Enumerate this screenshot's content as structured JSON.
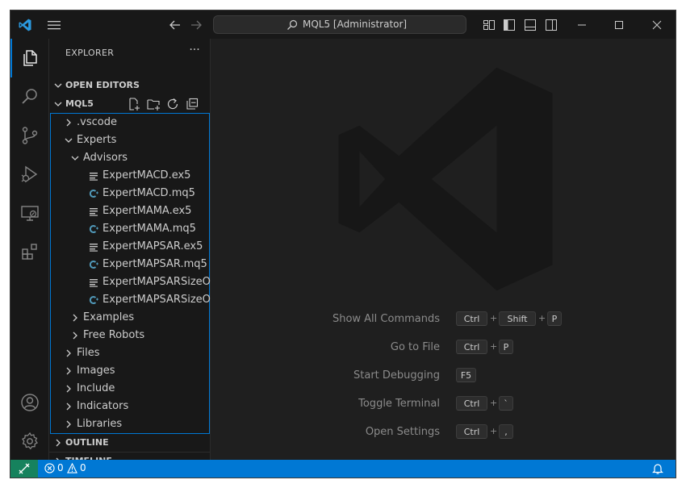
{
  "titlebar": {
    "command_center_text": "MQL5 [Administrator]",
    "back_icon": "arrow-left-icon",
    "forward_icon": "arrow-right-icon"
  },
  "activity_bar": {
    "items": [
      "files-icon",
      "search-icon",
      "source-control-icon",
      "run-debug-icon",
      "remote-explorer-icon",
      "extensions-icon"
    ],
    "bottom_items": [
      "account-icon",
      "manage-gear-icon"
    ]
  },
  "sidebar": {
    "title": "EXPLORER",
    "more": "···",
    "open_editors_label": "OPEN EDITORS",
    "folder_label": "MQL5",
    "outline_label": "OUTLINE",
    "timeline_label": "TIMELINE",
    "tree": [
      {
        "name": ".vscode",
        "type": "folder",
        "expanded": false,
        "depth": 0
      },
      {
        "name": "Experts",
        "type": "folder",
        "expanded": true,
        "depth": 0
      },
      {
        "name": "Advisors",
        "type": "folder",
        "expanded": true,
        "depth": 1
      },
      {
        "name": "ExpertMACD.ex5",
        "type": "file-lines",
        "depth": 2
      },
      {
        "name": "ExpertMACD.mq5",
        "type": "file-c",
        "depth": 2
      },
      {
        "name": "ExpertMAMA.ex5",
        "type": "file-lines",
        "depth": 2
      },
      {
        "name": "ExpertMAMA.mq5",
        "type": "file-c",
        "depth": 2
      },
      {
        "name": "ExpertMAPSAR.ex5",
        "type": "file-lines",
        "depth": 2
      },
      {
        "name": "ExpertMAPSAR.mq5",
        "type": "file-c",
        "depth": 2
      },
      {
        "name": "ExpertMAPSARSizeOpti...",
        "type": "file-lines",
        "depth": 2
      },
      {
        "name": "ExpertMAPSARSizeOpti...",
        "type": "file-c",
        "depth": 2
      },
      {
        "name": "Examples",
        "type": "folder",
        "expanded": false,
        "depth": 1
      },
      {
        "name": "Free Robots",
        "type": "folder",
        "expanded": false,
        "depth": 1
      },
      {
        "name": "Files",
        "type": "folder",
        "expanded": false,
        "depth": 0
      },
      {
        "name": "Images",
        "type": "folder",
        "expanded": false,
        "depth": 0
      },
      {
        "name": "Include",
        "type": "folder",
        "expanded": false,
        "depth": 0
      },
      {
        "name": "Indicators",
        "type": "folder",
        "expanded": false,
        "depth": 0
      },
      {
        "name": "Libraries",
        "type": "folder",
        "expanded": false,
        "depth": 0
      }
    ]
  },
  "editor": {
    "shortcuts": [
      {
        "label": "Show All Commands",
        "keys": [
          "Ctrl",
          "Shift",
          "P"
        ]
      },
      {
        "label": "Go to File",
        "keys": [
          "Ctrl",
          "P"
        ]
      },
      {
        "label": "Start Debugging",
        "keys": [
          "F5"
        ]
      },
      {
        "label": "Toggle Terminal",
        "keys": [
          "Ctrl",
          "`"
        ]
      },
      {
        "label": "Open Settings",
        "keys": [
          "Ctrl",
          ","
        ]
      }
    ]
  },
  "statusbar": {
    "errors": "0",
    "warnings": "0"
  },
  "colors": {
    "accent": "#0078d4",
    "remote": "#16825d",
    "background": "#1f1f1f",
    "sidebar": "#181818"
  }
}
